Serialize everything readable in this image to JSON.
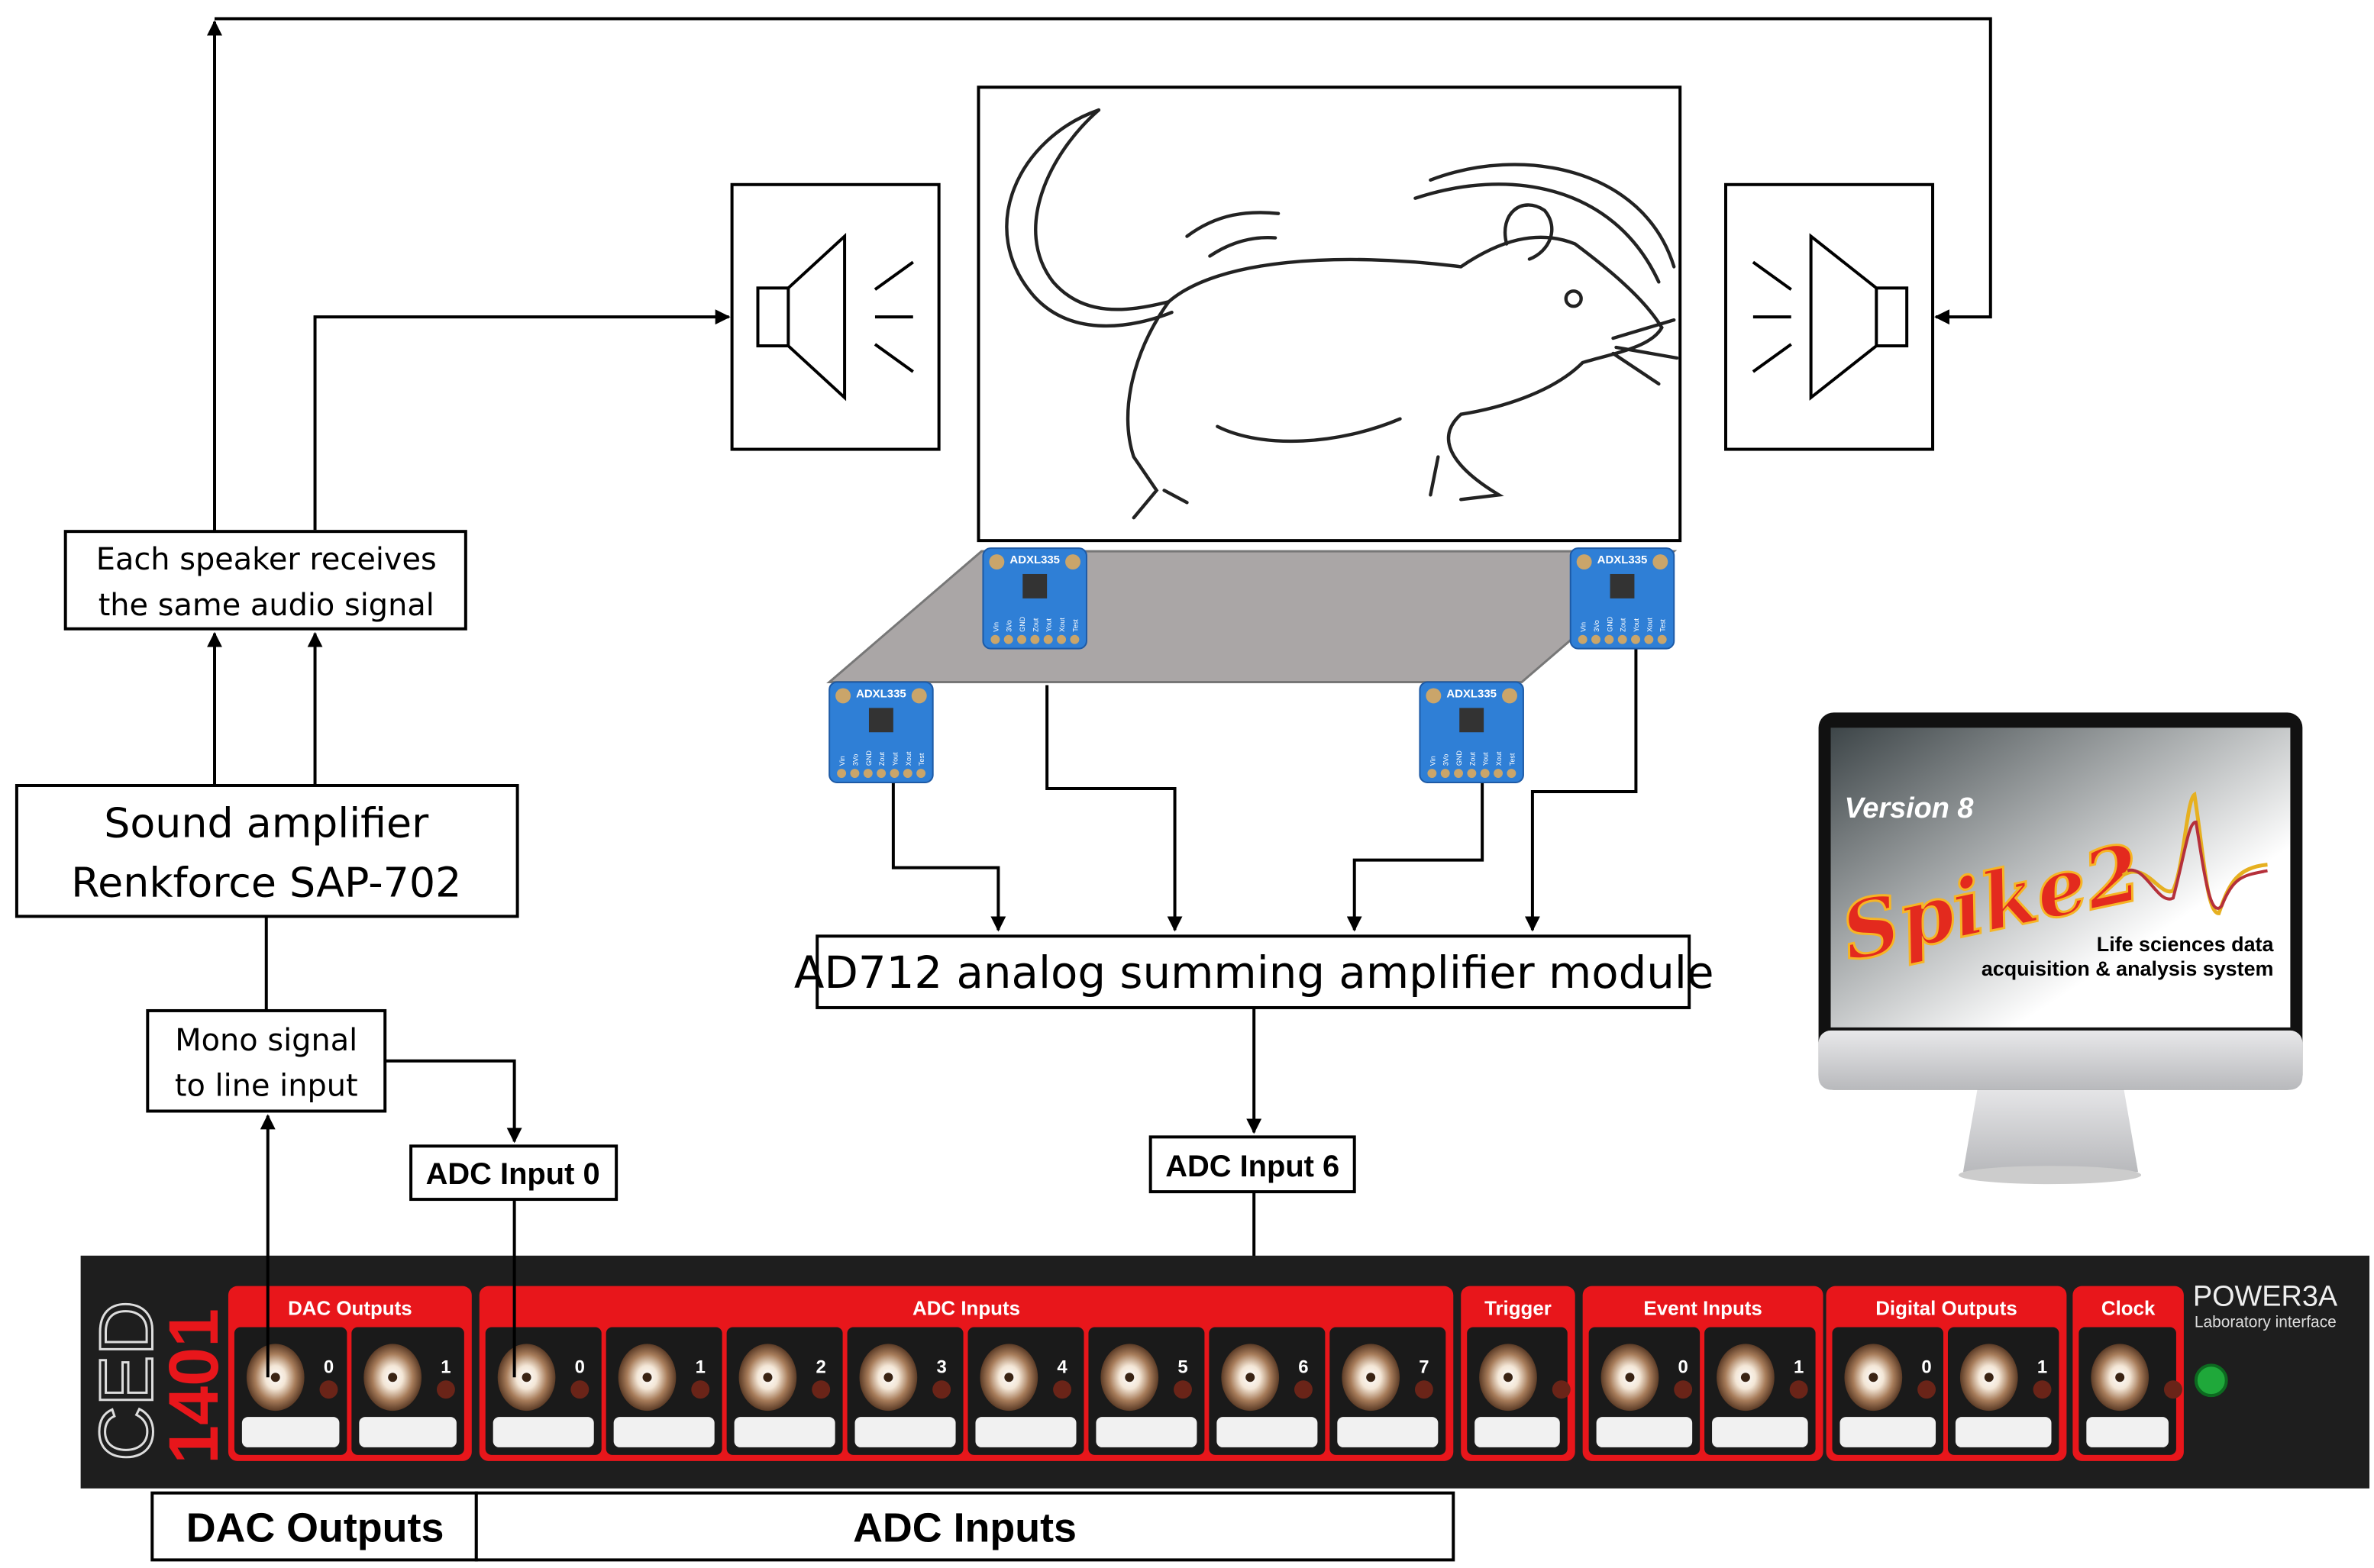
{
  "labels": {
    "speakers_note_line1": "Each speaker receives",
    "speakers_note_line2": "the same audio signal",
    "amplifier_line1": "Sound amplifier",
    "amplifier_line2": "Renkforce SAP-702",
    "mono_line1": "Mono signal",
    "mono_line2": "to line input",
    "adc_input_0": "ADC Input 0",
    "adc_input_6": "ADC Input 6",
    "summing_module": "AD712 analog summing amplifier module",
    "bottom_dac": "DAC Outputs",
    "bottom_adc": "ADC Inputs"
  },
  "sensor": {
    "model": "ADXL335",
    "pins": [
      "Vin",
      "3Vo",
      "GND",
      "Zout",
      "Yout",
      "Xout",
      "Test"
    ]
  },
  "software": {
    "version": "Version 8",
    "logo": "Spike2",
    "tagline_line1": "Life sciences data",
    "tagline_line2": "acquisition & analysis system"
  },
  "device": {
    "brand": "CED",
    "model": "1401",
    "name": "POWER3A",
    "subtitle": "Laboratory interface",
    "groups": [
      {
        "title": "DAC Outputs",
        "channels": [
          "0",
          "1"
        ]
      },
      {
        "title": "ADC Inputs",
        "channels": [
          "0",
          "1",
          "2",
          "3",
          "4",
          "5",
          "6",
          "7"
        ]
      },
      {
        "title": "Trigger",
        "channels": [
          ""
        ]
      },
      {
        "title": "Event Inputs",
        "channels": [
          "0",
          "1"
        ]
      },
      {
        "title": "Digital Outputs",
        "channels": [
          "0",
          "1"
        ]
      },
      {
        "title": "Clock",
        "channels": [
          ""
        ]
      }
    ],
    "colors": {
      "panel": "#1e1e1e",
      "accent": "#e8161b",
      "power_led": "#1fa83a"
    }
  }
}
